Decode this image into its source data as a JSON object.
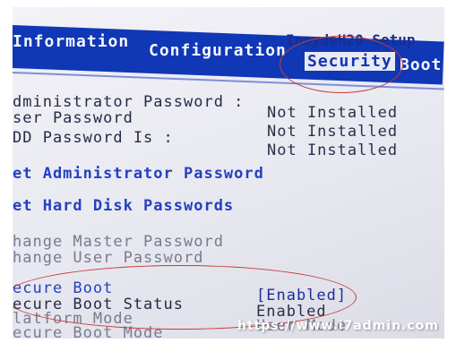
{
  "tabs": {
    "information": "Information",
    "configuration": "Configuration",
    "security": "Security",
    "boot": "Boot"
  },
  "setup_title": "InsydeH20 Setup",
  "passwords": [
    {
      "label": "dministrator Password :",
      "value": "Not Installed"
    },
    {
      "label": "ser Password",
      "value": "Not Installed"
    },
    {
      "label": "DD Password Is :",
      "value": "Not Installed"
    }
  ],
  "actions": {
    "set_admin_password": "et Administrator Password",
    "set_hdd_passwords": "et Hard Disk Passwords"
  },
  "disabled_items": {
    "change_master": "hange Master Password",
    "change_user": "hange User Password"
  },
  "secure_boot": {
    "label": "ecure Boot",
    "value": "[Enabled]",
    "status_label": "ecure Boot Status",
    "status_value": "Enabled",
    "platform_mode_label": "latform Mode",
    "platform_mode_value": "User Mode",
    "secure_boot_mode_label": "ecure Boot Mode"
  },
  "watermark": "https://www.i7admin.com",
  "colors": {
    "bios_blue": "#0f37b6",
    "screen_bg": "#ececf3",
    "annotation_red": "#c83a3a"
  }
}
